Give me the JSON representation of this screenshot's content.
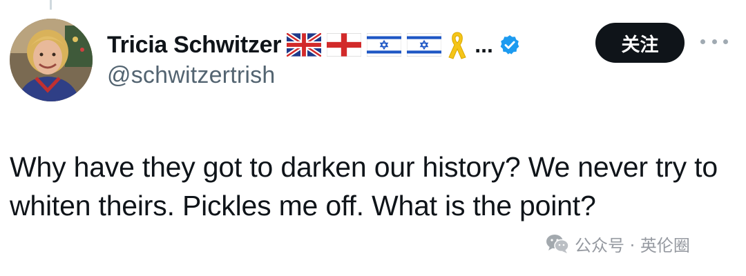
{
  "author": {
    "display_name": "Tricia Schwitzer",
    "handle": "@schwitzertrish",
    "name_suffix": "...",
    "badges": [
      "uk-flag-icon",
      "england-flag-icon",
      "israel-flag-icon",
      "israel-flag-icon",
      "yellow-ribbon-icon"
    ],
    "verified": true
  },
  "actions": {
    "follow_label": "关注"
  },
  "tweet": {
    "text": "Why have they got to darken our history? We never try to whiten theirs. Pickles me off. What is the point?"
  },
  "watermark": {
    "text": "公众号 · 英伦圈"
  },
  "colors": {
    "text": "#0f1419",
    "secondary": "#536471",
    "verified": "#1d9bf0",
    "button_bg": "#0f1419",
    "ribbon": "#f5c518"
  }
}
